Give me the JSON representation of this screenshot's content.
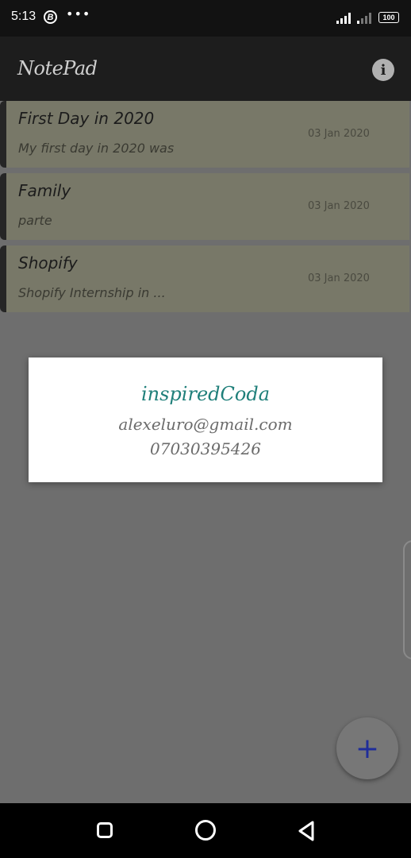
{
  "status_bar": {
    "time": "5:13",
    "b_badge": "B",
    "dots": "•••",
    "battery": "100"
  },
  "app_bar": {
    "title": "NotePad",
    "info_glyph": "i"
  },
  "notes": [
    {
      "title": "First Day in 2020",
      "body": "My first day in 2020 was",
      "date": "03 Jan 2020"
    },
    {
      "title": "Family",
      "body": "parte",
      "date": "03 Jan 2020"
    },
    {
      "title": "Shopify",
      "body": "Shopify Internship in ...",
      "date": "03 Jan 2020"
    }
  ],
  "dialog": {
    "name": "inspiredCoda",
    "email": "alexeluro@gmail.com",
    "phone": "07030395426"
  },
  "fab": {
    "glyph": "+"
  },
  "colors": {
    "card_bg": "#787868",
    "dialog_name": "#1f7f7a",
    "fab_plus": "#1f2d9a"
  },
  "icons": [
    "info-icon",
    "plus-icon",
    "recent-apps-icon",
    "home-icon",
    "back-icon",
    "signal-icon",
    "battery-icon"
  ]
}
